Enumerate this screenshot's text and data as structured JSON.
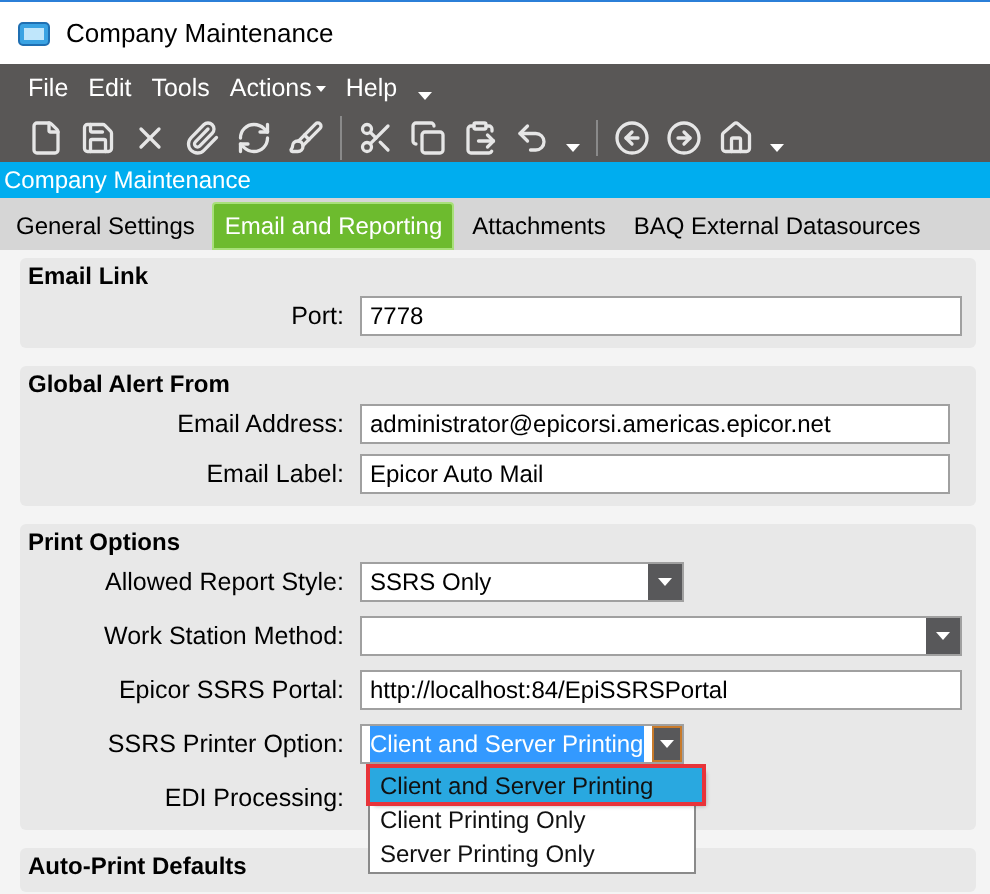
{
  "window": {
    "title": "Company Maintenance"
  },
  "menu": [
    {
      "label": "File",
      "has_caret": false
    },
    {
      "label": "Edit",
      "has_caret": false
    },
    {
      "label": "Tools",
      "has_caret": false
    },
    {
      "label": "Actions",
      "has_caret": true
    },
    {
      "label": "Help",
      "has_caret": false
    }
  ],
  "form_title": "Company Maintenance",
  "tabs": [
    {
      "label": "General Settings",
      "selected": false
    },
    {
      "label": "Email and Reporting",
      "selected": true
    },
    {
      "label": "Attachments",
      "selected": false
    },
    {
      "label": "BAQ External Datasources",
      "selected": false
    }
  ],
  "groups": [
    {
      "title": "Email Link",
      "fields": [
        {
          "label": "Port:",
          "kind": "text",
          "value": "7778"
        }
      ]
    },
    {
      "title": "Global Alert From",
      "fields": [
        {
          "label": "Email Address:",
          "kind": "text",
          "value": "administrator@epicorsi.americas.epicor.net"
        },
        {
          "label": "Email Label:",
          "kind": "text",
          "value": "Epicor Auto Mail"
        }
      ]
    },
    {
      "title": "Print Options",
      "fields": [
        {
          "label": "Allowed Report Style:",
          "kind": "combo",
          "value": "SSRS Only"
        },
        {
          "label": "Work Station Method:",
          "kind": "combo"
        },
        {
          "label": "Epicor SSRS Portal:",
          "kind": "text",
          "value": "http://localhost:84/EpiSSRSPortal"
        },
        {
          "label": "SSRS Printer Option:",
          "kind": "combo",
          "value": "Client and Server Printing",
          "highlighted": true,
          "open": true
        },
        {
          "label": "EDI Processing:",
          "kind": "covered"
        }
      ]
    },
    {
      "title": "Auto-Print Defaults"
    }
  ],
  "dropdown": {
    "options": [
      {
        "label": "Client and Server Printing",
        "selected": true
      },
      {
        "label": "Client Printing Only",
        "selected": false
      },
      {
        "label": "Server Printing Only",
        "selected": false
      }
    ]
  }
}
